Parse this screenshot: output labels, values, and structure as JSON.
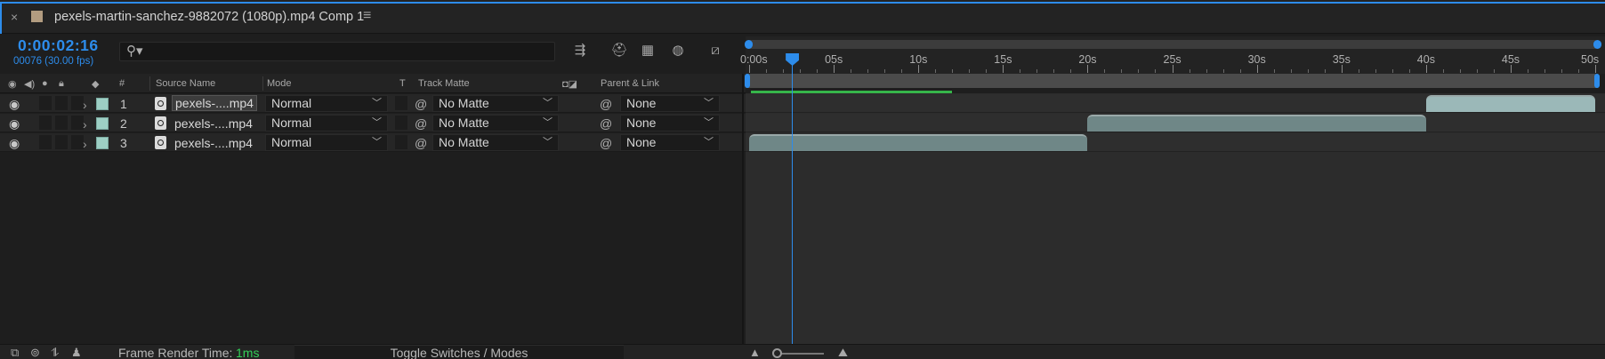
{
  "tab": {
    "close": "×",
    "title": "pexels-martin-sanchez-9882072 (1080p).mp4 Comp 1",
    "menu": "≡",
    "swatch_color": "#b29c80"
  },
  "time": {
    "timecode": "0:00:02:16",
    "frames": "00076 (30.00 fps)"
  },
  "search": {
    "placeholder": ""
  },
  "toolbar_icons": [
    "composition-flowchart-icon",
    "draft-3d-icon",
    "frame-blending-icon",
    "motion-blur-icon",
    "graph-editor-icon"
  ],
  "columns": {
    "source_name": "Source Name",
    "mode": "Mode",
    "t": "T",
    "track_matte": "Track Matte",
    "parent_link": "Parent & Link",
    "number": "#"
  },
  "layers": [
    {
      "num": "1",
      "source": "pexels-....mp4",
      "mode": "Normal",
      "matte": "No Matte",
      "parent": "None",
      "selected": true,
      "label_color": "#9dcfc4"
    },
    {
      "num": "2",
      "source": "pexels-....mp4",
      "mode": "Normal",
      "matte": "No Matte",
      "parent": "None",
      "selected": false,
      "label_color": "#9dcfc4"
    },
    {
      "num": "3",
      "source": "pexels-....mp4",
      "mode": "Normal",
      "matte": "No Matte",
      "parent": "None",
      "selected": false,
      "label_color": "#9dcfc4"
    }
  ],
  "ruler": {
    "labels": [
      "0:00s",
      "05s",
      "10s",
      "15s",
      "20s",
      "25s",
      "30s",
      "35s",
      "40s",
      "45s",
      "50s"
    ],
    "duration_seconds": 50,
    "current_time_seconds": 2.53
  },
  "layer_spans_seconds": [
    {
      "in": 40,
      "out": 50
    },
    {
      "in": 20,
      "out": 40
    },
    {
      "in": 0,
      "out": 20
    }
  ],
  "footer": {
    "frame_render_label": "Frame Render Time:",
    "frame_render_value": "1ms",
    "toggle_label": "Toggle Switches / Modes"
  },
  "colors": {
    "accent": "#2d8ceb",
    "render_ok": "#33d058",
    "label": "#9dcfc4"
  }
}
